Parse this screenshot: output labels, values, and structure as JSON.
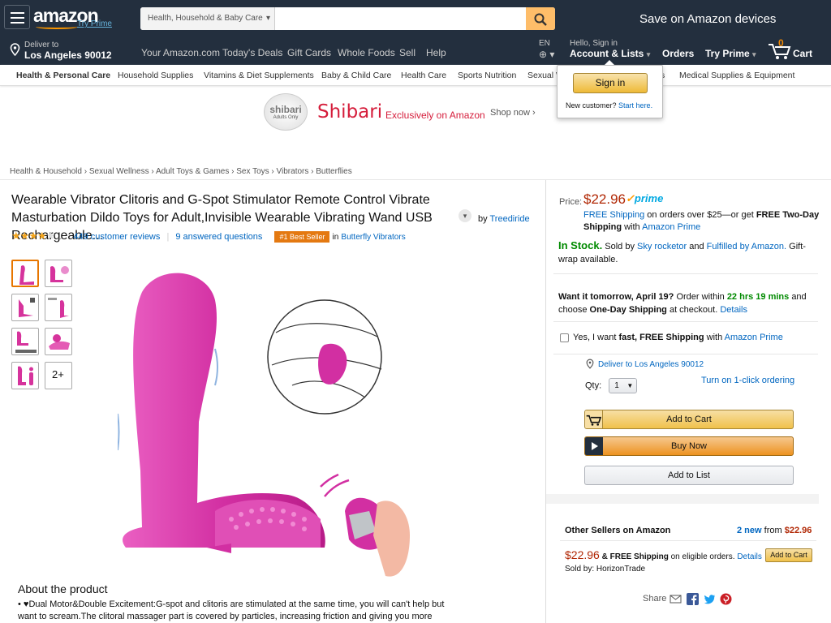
{
  "header": {
    "logo": "amazon",
    "try_prime": "Try Prime",
    "search_category": "Health, Household & Baby Care",
    "search_value": "",
    "promo": "Save on Amazon devices",
    "deliver_label": "Deliver to",
    "deliver_location": "Los Angeles 90012",
    "nav_links": [
      "Your Amazon.com",
      "Today's Deals",
      "Gift Cards",
      "Whole Foods",
      "Sell",
      "Help"
    ],
    "lang": "EN",
    "hello": "Hello, Sign in",
    "account": "Account & Lists",
    "orders": "Orders",
    "try_prime_menu": "Try Prime",
    "cart_count": "0",
    "cart": "Cart"
  },
  "subnav": [
    "Health & Personal Care",
    "Household Supplies",
    "Vitamins & Diet Supplements",
    "Baby & Child Care",
    "Health Care",
    "Sports Nutrition",
    "Sexual W",
    "s",
    "Medical Supplies & Equipment"
  ],
  "signin_popup": {
    "button": "Sign in",
    "new_customer": "New customer?",
    "start_here": "Start here."
  },
  "banner": {
    "brand": "Shibari",
    "seal_text": "shibari",
    "seal_sub": "Adults Only",
    "tagline": "Exclusively on Amazon",
    "cta": "Shop now ›"
  },
  "breadcrumbs": [
    "Health & Household",
    "Sexual Wellness",
    "Adult Toys & Games",
    "Sex Toys",
    "Vibrators",
    "Butterflies"
  ],
  "product": {
    "title": "Wearable Vibrator Clitoris and G-Spot Stimulator Remote Control Vibrate Masturbation Dildo Toys for Adult,Invisible Wearable Vibrating Wand USB Rechargeable...",
    "by": "by",
    "brand": "Treediride",
    "rating": 4,
    "reviews": "449 customer reviews",
    "sep": "|",
    "questions": "9 answered questions",
    "badge": "#1 Best Seller",
    "badge_in": "in",
    "badge_category": "Butterfly Vibrators",
    "more_thumbs": "2+",
    "about_title": "About the product",
    "bullet": "♥Dual Motor&Double Excitement:G-spot and clitoris are stimulated at the same time, you will can't help but want to scream.The clitoral massager part is covered by particles, increasing friction and giving you more"
  },
  "buybox": {
    "price_label": "Price:",
    "price": "$22.96",
    "prime": "prime",
    "free_shipping": "FREE Shipping",
    "ship_text": "on orders over $25—or get",
    "two_day": "FREE Two-Day Shipping",
    "with": "with",
    "amazon_prime": "Amazon Prime",
    "in_stock": "In Stock.",
    "sold_by_label": "Sold by",
    "seller": "Sky rocketor",
    "and": "and",
    "fulfilled": "Fulfilled by Amazon.",
    "gift": "Gift-wrap available.",
    "want_tomorrow": "Want it tomorrow, April 19?",
    "order_within": "Order within",
    "countdown": "22 hrs 19 mins",
    "and_choose": "and choose",
    "one_day": "One-Day Shipping",
    "at_checkout": "at checkout.",
    "details": "Details",
    "fast_yes": "Yes, I want",
    "fast_free": "fast, FREE Shipping",
    "fast_with": "with",
    "deliver_to": "Deliver to Los Angeles 90012",
    "qty_label": "Qty:",
    "qty_value": "1",
    "one_click": "Turn on 1-click ordering",
    "add_to_cart": "Add to Cart",
    "buy_now": "Buy Now",
    "add_to_list": "Add to List"
  },
  "other_sellers": {
    "title": "Other Sellers on Amazon",
    "new_count": "2 new",
    "from": "from",
    "from_price": "$22.96",
    "price": "$22.96",
    "shipping_free": "& FREE Shipping",
    "shipping_text": "on eligible orders.",
    "details": "Details",
    "sold_by": "Sold by: HorizonTrade",
    "add_to_cart": "Add to Cart"
  },
  "share": {
    "label": "Share"
  },
  "colors": {
    "header_bg": "#232f3e",
    "accent": "#f90",
    "link": "#0066c0",
    "price": "#b12704",
    "in_stock": "#008a00",
    "product_pink": "#d6339c"
  }
}
